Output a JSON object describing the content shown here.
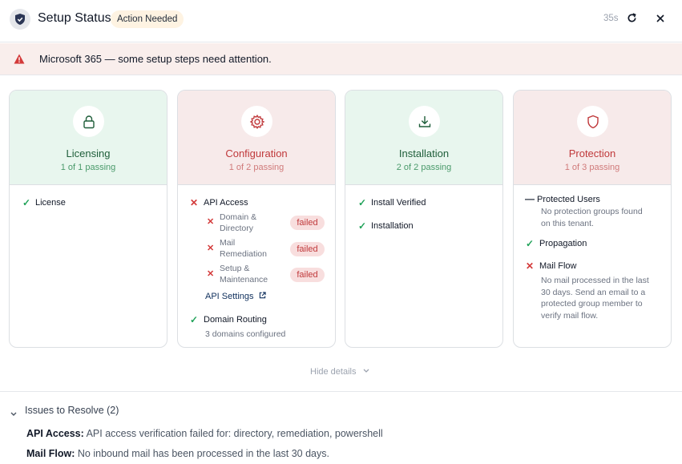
{
  "header": {
    "title": "Setup Status",
    "status_pill": "Action Needed",
    "timer": "35s"
  },
  "alert": {
    "text": "Microsoft 365 — some setup steps need attention."
  },
  "cards": {
    "licensing": {
      "name": "Licensing",
      "sub": "1 of 1 passing",
      "items": [
        "License"
      ]
    },
    "configuration": {
      "name": "Configuration",
      "sub": "1 of 2 passing",
      "api_access": "API Access",
      "subitems": [
        {
          "label_1": "Domain &",
          "label_2": "Directory",
          "status": "failed"
        },
        {
          "label_1": "Mail",
          "label_2": "Remediation",
          "status": "failed"
        },
        {
          "label_1": "Setup &",
          "label_2": "Maintenance",
          "status": "failed"
        }
      ],
      "api_settings": "API Settings",
      "domain_routing": "Domain Routing",
      "domain_routing_detail": "3 domains configured"
    },
    "installation": {
      "name": "Installation",
      "sub": "2 of 2 passing",
      "items": [
        "Install Verified",
        "Installation"
      ]
    },
    "protection": {
      "name": "Protection",
      "sub": "1 of 3 passing",
      "protected_users": "Protected Users",
      "protected_users_detail_1": "No protection groups found",
      "protected_users_detail_2": "on this tenant.",
      "propagation": "Propagation",
      "mail_flow": "Mail Flow",
      "mail_flow_detail": [
        "No mail processed in the last",
        "30 days. Send an email to a",
        "protected group member to",
        "verify mail flow."
      ]
    }
  },
  "hide_details": "Hide details",
  "issues": {
    "title": "Issues to Resolve (2)",
    "items": [
      {
        "label": "API Access:",
        "text": " API access verification failed for: directory, remediation, powershell"
      },
      {
        "label": "Mail Flow:",
        "text": " No inbound mail has been processed in the last 30 days."
      }
    ]
  },
  "colors": {
    "ok_bg": "#e8f6ee",
    "bad_bg": "#f7eaea",
    "ok_text": "#1f5e3a",
    "bad_text": "#c0393b",
    "alert_bg": "#f9eeec",
    "pill_bg": "#fef3e2"
  }
}
